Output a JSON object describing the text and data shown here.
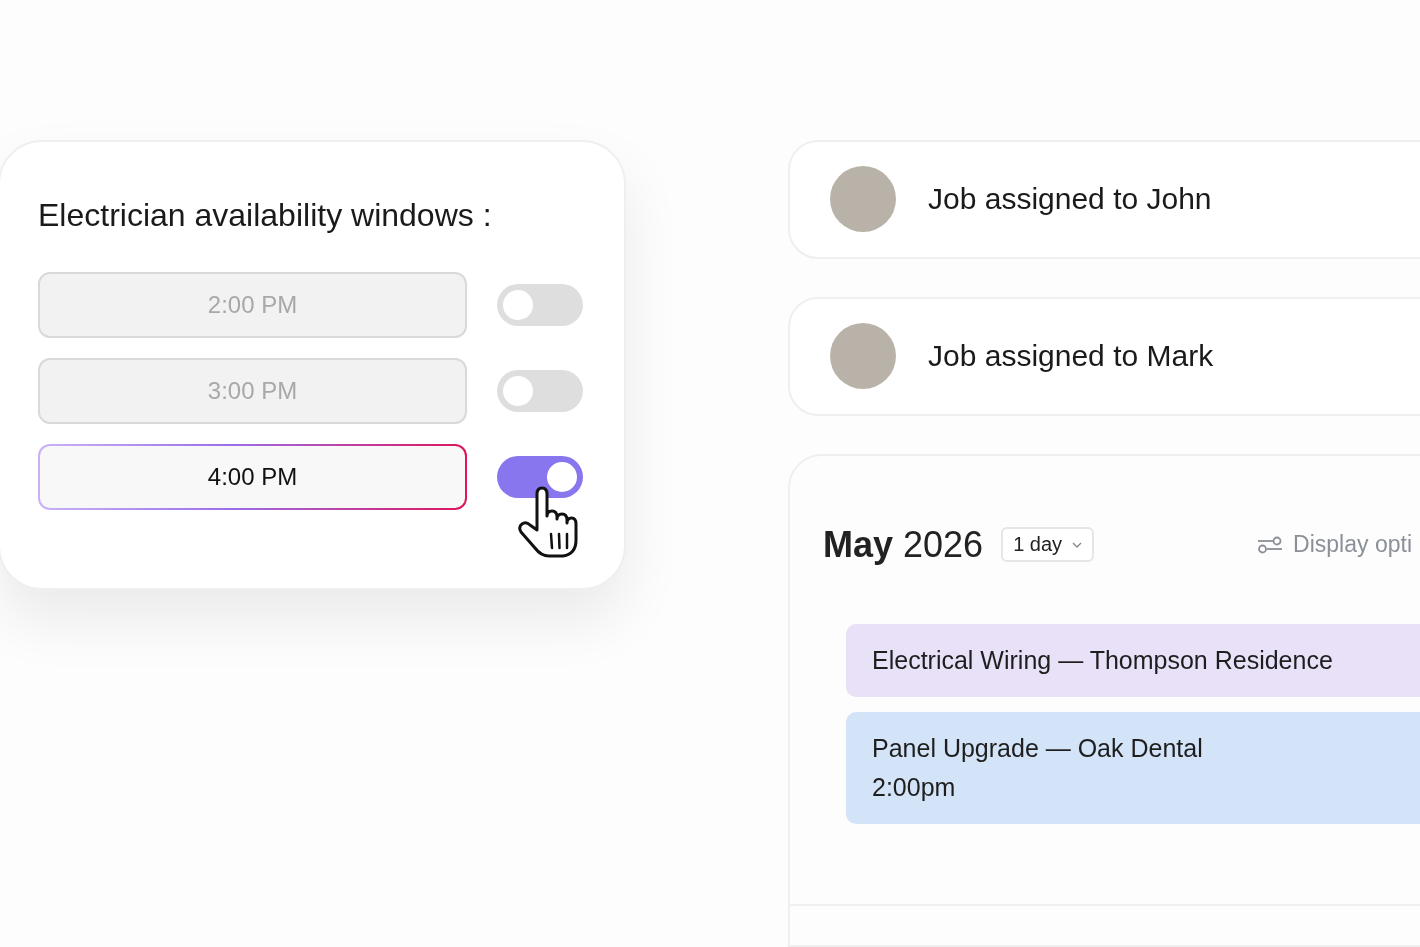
{
  "availability": {
    "title": "Electrician availability windows :",
    "slots": [
      {
        "time": "2:00 PM",
        "on": false
      },
      {
        "time": "3:00 PM",
        "on": false
      },
      {
        "time": "4:00 PM",
        "on": true
      }
    ]
  },
  "assignments": [
    {
      "text": "Job assigned to John"
    },
    {
      "text": "Job assigned to Mark"
    }
  ],
  "calendar": {
    "month": "May",
    "year": "2026",
    "range": "1 day",
    "display_options": "Display opti",
    "events": [
      {
        "title": "Electrical Wiring — Thompson Residence",
        "color": "#e8e1f8"
      },
      {
        "title": "Panel Upgrade — Oak Dental",
        "time": "2:00pm",
        "color": "#d3e3f8"
      }
    ]
  }
}
